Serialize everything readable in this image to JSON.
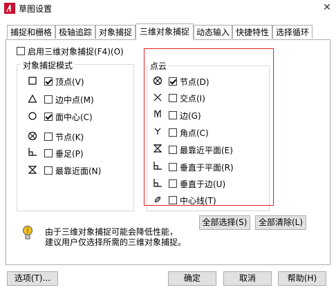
{
  "window": {
    "title": "草图设置",
    "close_glyph": "✕"
  },
  "tabs": [
    {
      "label": "捕捉和栅格"
    },
    {
      "label": "极轴追踪"
    },
    {
      "label": "对象捕捉"
    },
    {
      "label": "三维对象捕捉"
    },
    {
      "label": "动态输入"
    },
    {
      "label": "快捷特性"
    },
    {
      "label": "选择循环"
    }
  ],
  "enable_3d_snap": {
    "label": "启用三维对象捕捉(F4)(O)",
    "checked": false
  },
  "object_snap_mode": {
    "title": "对象捕捉模式",
    "items": [
      {
        "label": "顶点(V)",
        "checked": true,
        "icon": "vertex-square-icon"
      },
      {
        "label": "边中点(M)",
        "checked": false,
        "icon": "midpoint-triangle-icon"
      },
      {
        "label": "面中心(C)",
        "checked": true,
        "icon": "center-circle-icon"
      },
      {
        "label": "节点(K)",
        "checked": false,
        "icon": "node-icon"
      },
      {
        "label": "垂足(P)",
        "checked": false,
        "icon": "perpendicular-icon"
      },
      {
        "label": "最靠近面(N)",
        "checked": false,
        "icon": "nearest-hourglass-icon"
      }
    ]
  },
  "point_cloud": {
    "title": "点云",
    "items": [
      {
        "label": "节点(D)",
        "checked": true,
        "icon": "node-icon"
      },
      {
        "label": "交点(I)",
        "checked": false,
        "icon": "intersection-x-icon"
      },
      {
        "label": "边(G)",
        "checked": false,
        "icon": "edge-icon"
      },
      {
        "label": "角点(C)",
        "checked": false,
        "icon": "corner-y-icon"
      },
      {
        "label": "最靠近平面(E)",
        "checked": false,
        "icon": "nearest-plane-icon"
      },
      {
        "label": "垂直于平面(R)",
        "checked": false,
        "icon": "perpendicular-plane-icon"
      },
      {
        "label": "垂直于边(U)",
        "checked": false,
        "icon": "perpendicular-edge-icon"
      },
      {
        "label": "中心线(T)",
        "checked": false,
        "icon": "centerline-icon"
      }
    ]
  },
  "select_all_label": "全部选择(S)",
  "clear_all_label": "全部清除(L)",
  "hint": {
    "line1": "由于三维对象捕捉可能会降低性能，",
    "line2": "建议用户仅选择所需的三维对象捕捉。"
  },
  "footer": {
    "options_label": "选项(T)...",
    "ok_label": "确定",
    "cancel_label": "取消",
    "help_label": "帮助(H)"
  },
  "colors": {
    "highlight_border": "#e0201c",
    "hint_icon": "#f0c020"
  }
}
